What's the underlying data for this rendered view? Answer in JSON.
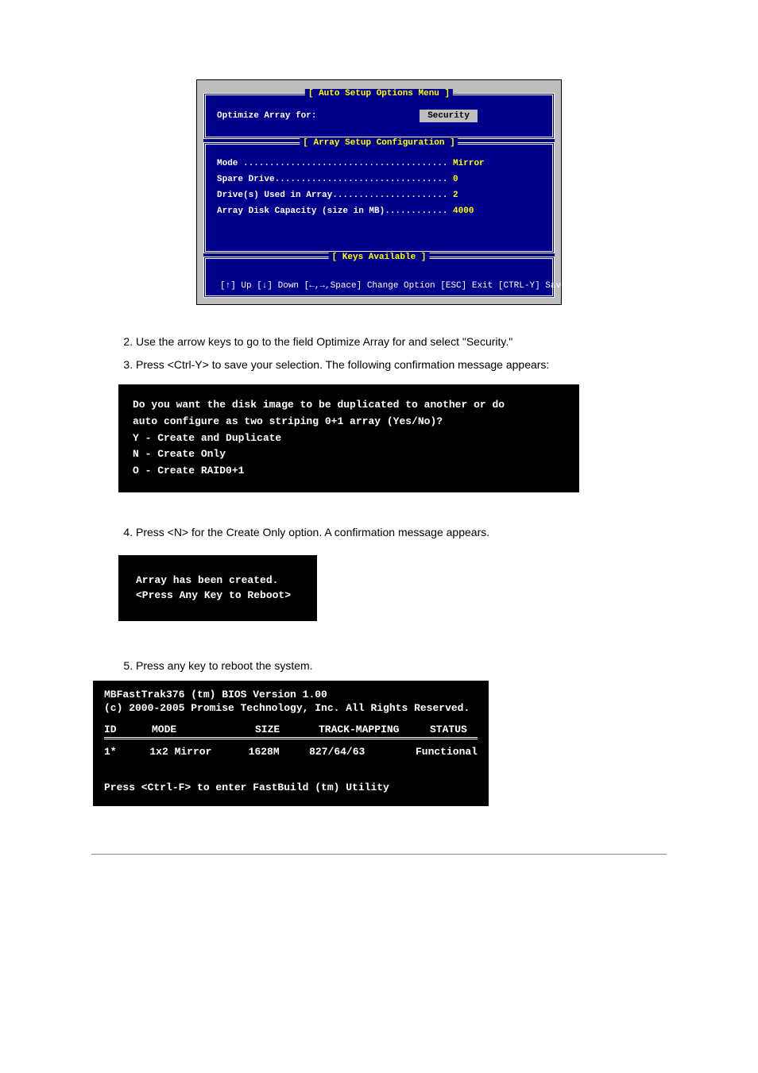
{
  "bios": {
    "panel1_title": "[ Auto Setup Options Menu ]",
    "optimize_label": "Optimize Array for:",
    "optimize_value": "Security",
    "panel2_title": "[ Array Setup Configuration ]",
    "config": [
      {
        "label": "Mode .......................................",
        "value": " Mirror"
      },
      {
        "label": "Spare Drive.................................",
        "value": " 0"
      },
      {
        "label": "Drive(s) Used in Array......................",
        "value": " 2"
      },
      {
        "label": "Array Disk Capacity (size in MB)............",
        "value": " 4000"
      }
    ],
    "panel3_title": "[ Keys Available ]",
    "keys_line": "[↑] Up  [↓] Down  [←,→,Space] Change Option  [ESC] Exit [CTRL-Y] Save"
  },
  "steps": {
    "s2": "Use the arrow keys to go to the field Optimize Array for and select \"Security.\"",
    "s3": "Press <Ctrl-Y> to save your selection. The following confirmation message appears:"
  },
  "prompt1": {
    "l1": "Do you want the disk image to be duplicated to another or do",
    "l2": "auto configure as two striping 0+1 array (Yes/No)?",
    "l3": "Y - Create and Duplicate",
    "l4": "N - Create Only",
    "l5": "O - Create RAID0+1"
  },
  "step4": "Press <N> for the Create Only option. A confirmation message appears.",
  "prompt2": {
    "l1": "Array has been created.",
    "l2": "<Press Any Key to Reboot>"
  },
  "step5": "Press any key to reboot the system.",
  "bios_table": {
    "h1": "MBFastTrak376 (tm) BIOS Version 1.00",
    "h2": "(c) 2000-2005 Promise Technology, Inc.  All Rights Reserved.",
    "cols": {
      "id": "ID",
      "mode": "MODE",
      "size": "SIZE",
      "track": "TRACK-MAPPING",
      "status": "STATUS"
    },
    "row": {
      "id": "1*",
      "mode": "1x2 Mirror",
      "size": "1628M",
      "track": "827/64/63",
      "status": "Functional"
    },
    "footer": "Press <Ctrl-F> to enter FastBuild (tm) Utility"
  }
}
